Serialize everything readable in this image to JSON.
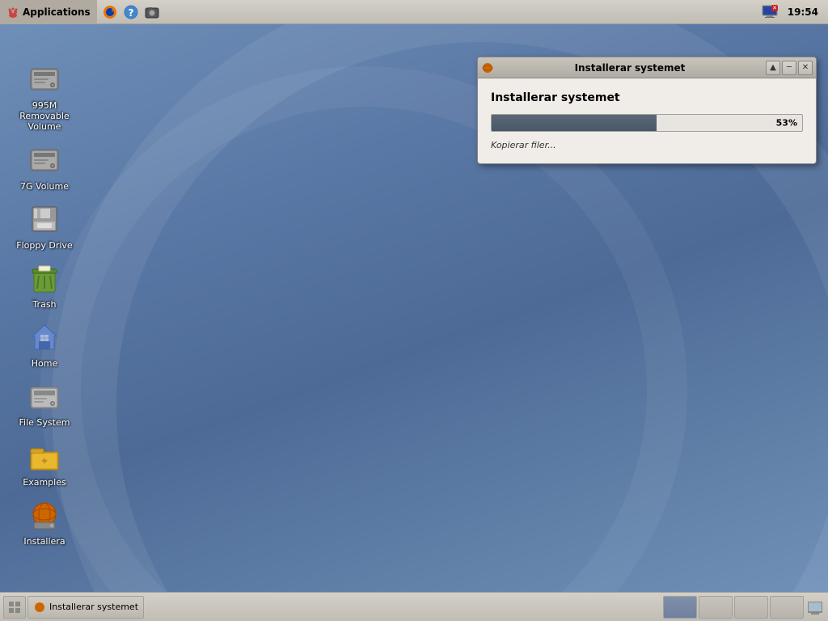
{
  "panel": {
    "apps_menu_label": "Applications",
    "clock": "19:54"
  },
  "desktop_icons": [
    {
      "id": "removable-volume",
      "label": "995M Removable Volume",
      "icon_type": "hdd"
    },
    {
      "id": "7g-volume",
      "label": "7G Volume",
      "icon_type": "hdd"
    },
    {
      "id": "floppy-drive",
      "label": "Floppy Drive",
      "icon_type": "floppy"
    },
    {
      "id": "trash",
      "label": "Trash",
      "icon_type": "trash"
    },
    {
      "id": "home",
      "label": "Home",
      "icon_type": "home"
    },
    {
      "id": "file-system",
      "label": "File System",
      "icon_type": "filesystem"
    },
    {
      "id": "examples",
      "label": "Examples",
      "icon_type": "folder"
    },
    {
      "id": "installera",
      "label": "Installera",
      "icon_type": "installer"
    }
  ],
  "dialog": {
    "title": "Installerar systemet",
    "heading": "Installerar systemet",
    "progress_percent": 53,
    "progress_label": "53%",
    "status_text": "Kopierar filer..."
  },
  "taskbar": {
    "window_label": "Installerar systemet"
  }
}
